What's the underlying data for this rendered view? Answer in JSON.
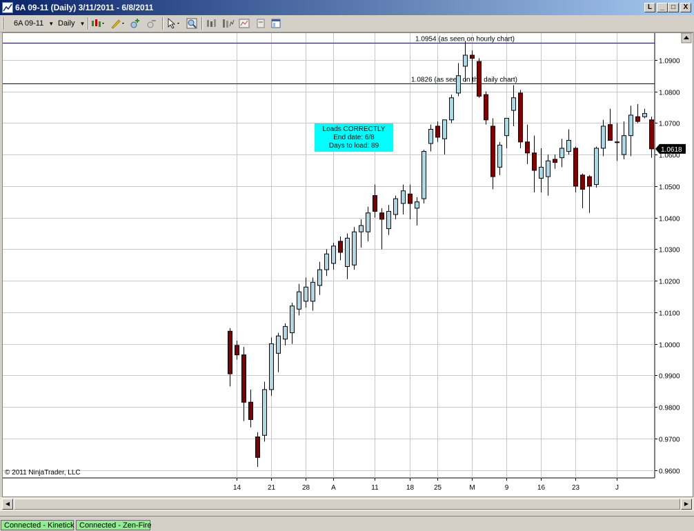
{
  "window": {
    "title": "6A 09-11 (Daily)  3/11/2011 - 6/8/2011",
    "controls": [
      "L",
      "_",
      "□",
      "X"
    ]
  },
  "toolbar": {
    "instrument": "6A 09-11",
    "period": "Daily",
    "icons": [
      "candlestick-style-icon",
      "pencil-draw-icon",
      "zoom-in-icon",
      "zoom-out-icon",
      "cursor-pointer-icon",
      "magnify-icon",
      "bar-data-icon",
      "indicators-icon",
      "strategy-icon",
      "properties-icon",
      "panel-icon"
    ]
  },
  "statusbar": {
    "items": [
      "Connected - Kinetick",
      "Connected - Zen-Fire"
    ]
  },
  "chart_data": {
    "type": "candlestick",
    "copyright": "© 2011 NinjaTrader, LLC",
    "current_price_label": "1.0618",
    "ylim": [
      0.9575,
      1.0985
    ],
    "y_ticks": [
      "1.0900",
      "1.0800",
      "1.0700",
      "1.0600",
      "1.0500",
      "1.0400",
      "1.0300",
      "1.0200",
      "1.0100",
      "1.0000",
      "0.9900",
      "0.9800",
      "0.9700",
      "0.9600"
    ],
    "x_ticks": [
      {
        "label": "14",
        "index": 1
      },
      {
        "label": "21",
        "index": 6
      },
      {
        "label": "28",
        "index": 11
      },
      {
        "label": "A",
        "index": 15
      },
      {
        "label": "11",
        "index": 21
      },
      {
        "label": "18",
        "index": 26
      },
      {
        "label": "25",
        "index": 30
      },
      {
        "label": "M",
        "index": 35
      },
      {
        "label": "9",
        "index": 40
      },
      {
        "label": "16",
        "index": 45
      },
      {
        "label": "23",
        "index": 50
      },
      {
        "label": "J",
        "index": 56
      }
    ],
    "hlines": [
      {
        "value": 1.0954,
        "label": "1.0954 (as seen on hourly chart)"
      },
      {
        "value": 1.0826,
        "label": "1.0826 (as seen on the daily chart)"
      }
    ],
    "annotation": {
      "lines": [
        "Loads CORRECTLY",
        "End date: 6/8",
        "Days to load: 89"
      ],
      "background": "#00ffff"
    },
    "colors": {
      "up": "#add8e6",
      "down": "#800000",
      "grid": "#c8c8c8",
      "hline": "#000080"
    },
    "candles": [
      [
        1.004,
        1.005,
        0.9865,
        0.9905
      ],
      [
        0.9995,
        1.001,
        0.995,
        0.9965
      ],
      [
        0.9965,
        0.999,
        0.9755,
        0.9815
      ],
      [
        0.9815,
        0.9855,
        0.9735,
        0.976
      ],
      [
        0.9705,
        0.972,
        0.961,
        0.964
      ],
      [
        0.971,
        0.988,
        0.969,
        0.9855
      ],
      [
        0.9855,
        1.002,
        0.9835,
        1.0
      ],
      [
        0.997,
        1.0035,
        0.991,
        1.0025
      ],
      [
        1.0015,
        1.0065,
        0.9995,
        1.0055
      ],
      [
        1.0035,
        1.013,
        1.0,
        1.012
      ],
      [
        1.011,
        1.019,
        1.009,
        1.0165
      ],
      [
        1.0135,
        1.021,
        1.0115,
        1.018
      ],
      [
        1.0135,
        1.021,
        1.0105,
        1.0195
      ],
      [
        1.0185,
        1.026,
        1.0155,
        1.0235
      ],
      [
        1.0235,
        1.03,
        1.0215,
        1.0285
      ],
      [
        1.0255,
        1.032,
        1.0235,
        1.031
      ],
      [
        1.0325,
        1.034,
        1.0265,
        1.029
      ],
      [
        1.0245,
        1.035,
        1.0205,
        1.0335
      ],
      [
        1.025,
        1.037,
        1.0235,
        1.0355
      ],
      [
        1.0355,
        1.0395,
        1.0305,
        1.0375
      ],
      [
        1.0355,
        1.0435,
        1.0325,
        1.0415
      ],
      [
        1.047,
        1.0505,
        1.04,
        1.042
      ],
      [
        1.0415,
        1.043,
        1.03,
        1.0395
      ],
      [
        1.0365,
        1.044,
        1.0345,
        1.042
      ],
      [
        1.041,
        1.047,
        1.0395,
        1.046
      ],
      [
        1.0445,
        1.0505,
        1.041,
        1.0485
      ],
      [
        1.0475,
        1.0505,
        1.0395,
        1.0445
      ],
      [
        1.043,
        1.0465,
        1.0375,
        1.045
      ],
      [
        1.046,
        1.0615,
        1.0445,
        1.061
      ],
      [
        1.0635,
        1.0695,
        1.061,
        1.068
      ],
      [
        1.069,
        1.0705,
        1.064,
        1.0655
      ],
      [
        1.065,
        1.071,
        1.06,
        1.071
      ],
      [
        1.071,
        1.079,
        1.07,
        1.078
      ],
      [
        1.0795,
        1.089,
        1.0785,
        1.085
      ],
      [
        1.088,
        1.096,
        1.083,
        1.0915
      ],
      [
        1.0915,
        1.093,
        1.0825,
        1.0905
      ],
      [
        1.0895,
        1.0905,
        1.078,
        1.0785
      ],
      [
        1.079,
        1.08,
        1.0695,
        1.071
      ],
      [
        1.069,
        1.0715,
        1.049,
        1.053
      ],
      [
        1.056,
        1.064,
        1.0535,
        1.063
      ],
      [
        1.066,
        1.071,
        1.062,
        1.0715
      ],
      [
        1.074,
        1.082,
        1.069,
        1.078
      ],
      [
        1.0795,
        1.0805,
        1.062,
        1.064
      ],
      [
        1.064,
        1.0695,
        1.057,
        1.0605
      ],
      [
        1.0605,
        1.066,
        1.048,
        1.055
      ],
      [
        1.0525,
        1.062,
        1.048,
        1.056
      ],
      [
        1.053,
        1.06,
        1.047,
        1.058
      ],
      [
        1.0585,
        1.06,
        1.0555,
        1.0575
      ],
      [
        1.059,
        1.065,
        1.056,
        1.062
      ],
      [
        1.061,
        1.068,
        1.06,
        1.0645
      ],
      [
        1.062,
        1.0625,
        1.048,
        1.05
      ],
      [
        1.0535,
        1.054,
        1.043,
        1.049
      ],
      [
        1.053,
        1.0535,
        1.0415,
        1.05
      ],
      [
        1.0505,
        1.0625,
        1.0495,
        1.062
      ],
      [
        1.062,
        1.071,
        1.0595,
        1.069
      ],
      [
        1.0695,
        1.0745,
        1.065,
        1.0645
      ],
      [
        1.064,
        1.07,
        1.058,
        1.064
      ],
      [
        1.06,
        1.0705,
        1.0585,
        1.066
      ],
      [
        1.066,
        1.0755,
        1.0595,
        1.0725
      ],
      [
        1.072,
        1.076,
        1.07,
        1.0705
      ],
      [
        1.072,
        1.0745,
        1.0715,
        1.073
      ],
      [
        1.071,
        1.072,
        1.059,
        1.0618
      ]
    ]
  }
}
